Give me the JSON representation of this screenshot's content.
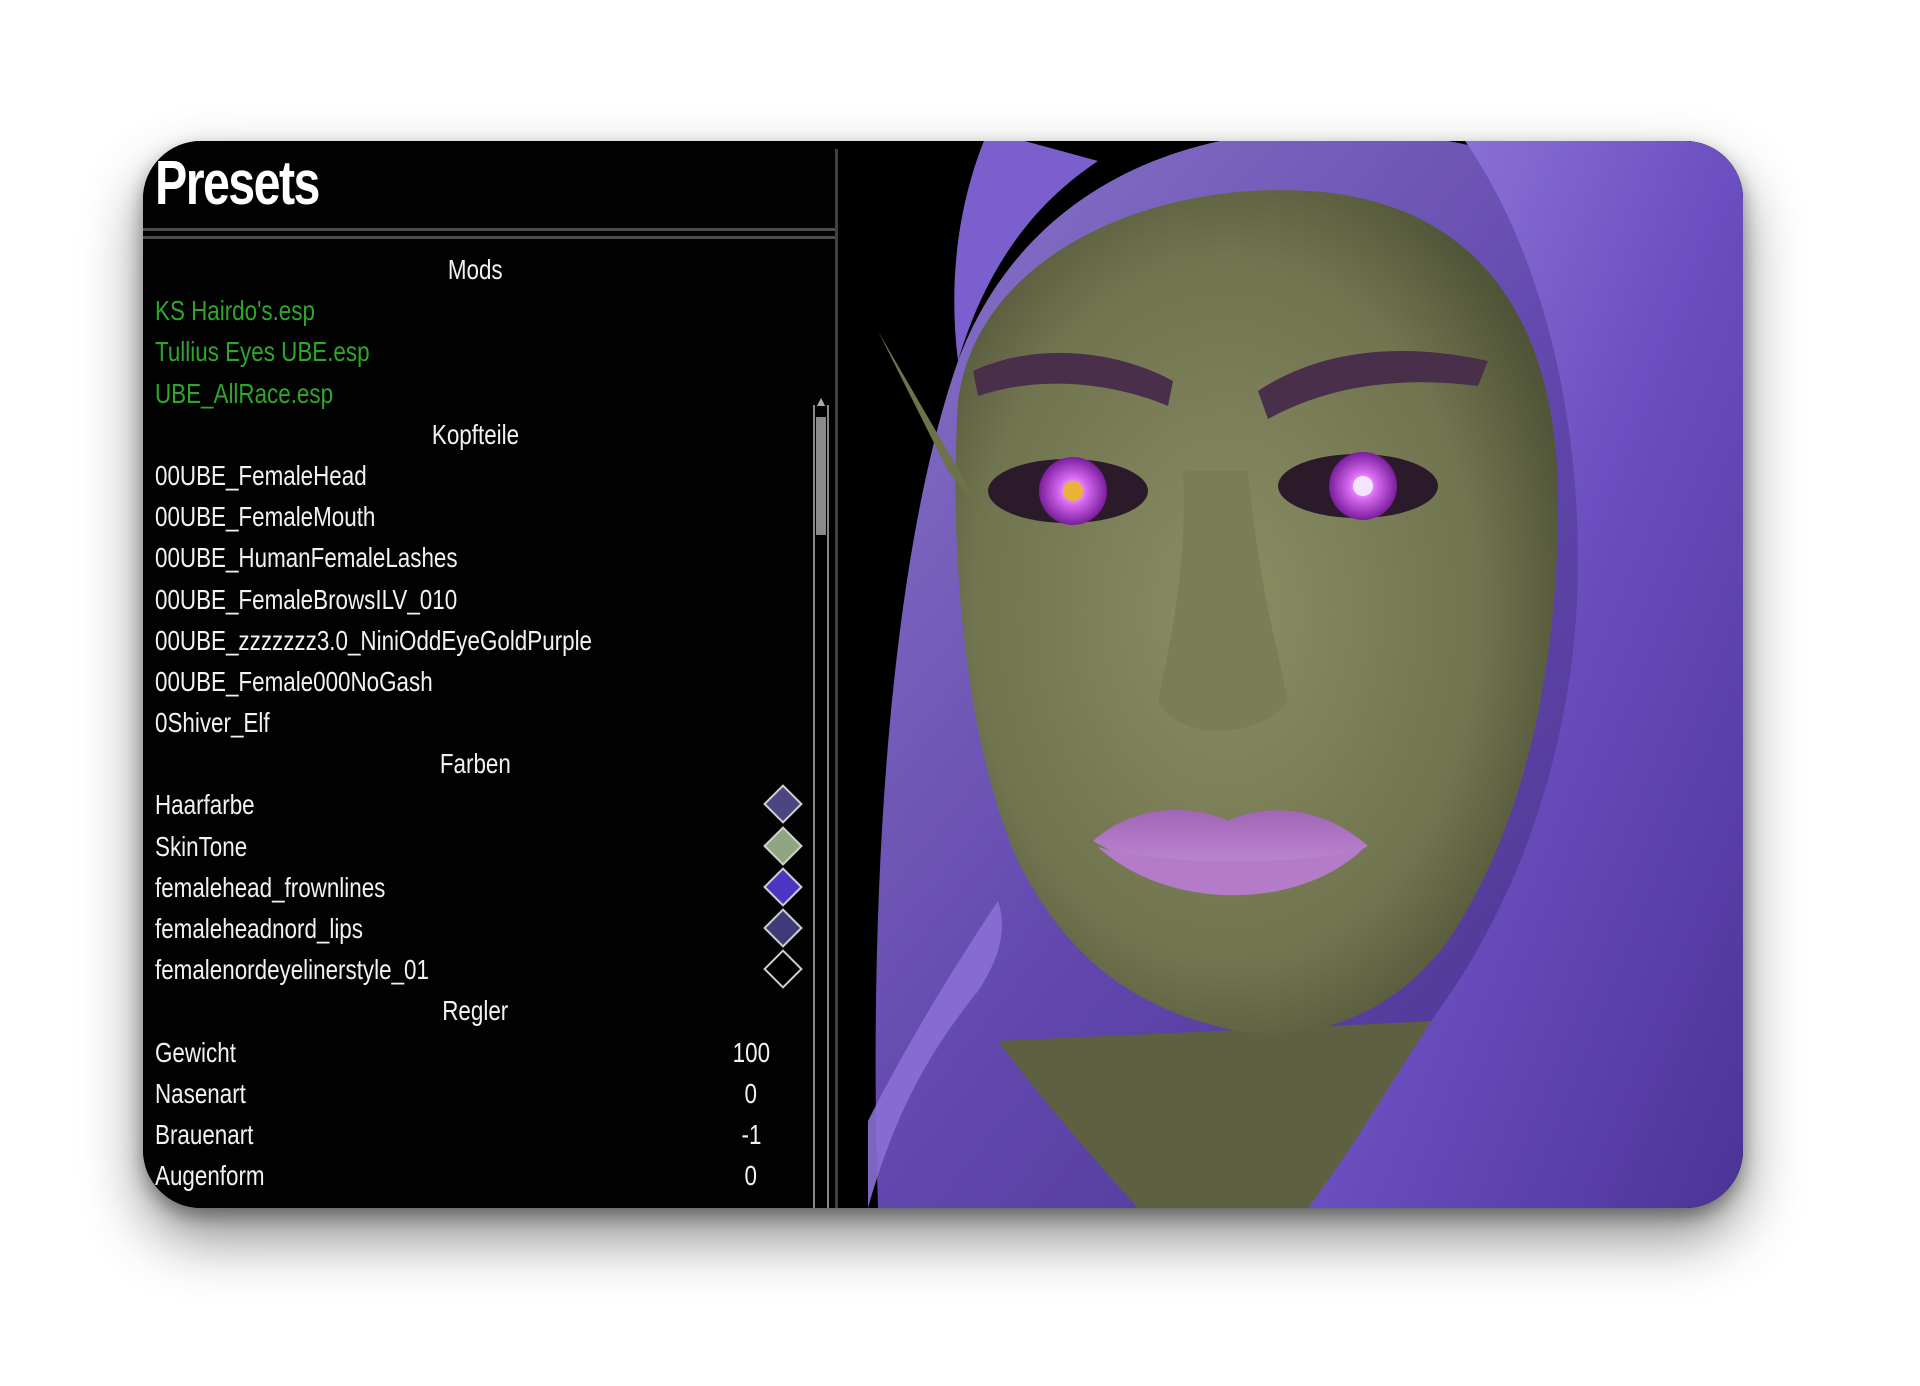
{
  "panel": {
    "title": "Presets",
    "sections": {
      "mods": "Mods",
      "headparts": "Kopfteile",
      "colors": "Farben",
      "sliders": "Regler"
    },
    "mods": [
      "KS Hairdo's.esp",
      "Tullius Eyes UBE.esp",
      "UBE_AllRace.esp"
    ],
    "headparts": [
      "00UBE_FemaleHead",
      "00UBE_FemaleMouth",
      "00UBE_HumanFemaleLashes",
      "00UBE_FemaleBrowsILV_010",
      "00UBE_zzzzzzz3.0_NiniOddEyeGoldPurple",
      "00UBE_Female000NoGash",
      "0Shiver_Elf"
    ],
    "colors": [
      {
        "label": "Haarfarbe",
        "color": "#4c4680"
      },
      {
        "label": "SkinTone",
        "color": "#8fa781"
      },
      {
        "label": "femalehead_frownlines",
        "color": "#4b36c4"
      },
      {
        "label": "femaleheadnord_lips",
        "color": "#3f3a78"
      },
      {
        "label": "femalenordeyelinerstyle_01",
        "color": "#000000"
      }
    ],
    "sliders": [
      {
        "label": "Gewicht",
        "value": "100"
      },
      {
        "label": "Nasenart",
        "value": "0"
      },
      {
        "label": "Brauenart",
        "value": "-1"
      },
      {
        "label": "Augenform",
        "value": "0"
      }
    ],
    "accent_mod_color": "#2fa62a"
  },
  "portrait": {
    "subject": "green-skinned elf with purple hair and violet eyes",
    "hair_color": "#7a5fc4",
    "skin_color": "#7d805a",
    "lip_color": "#9a62b0"
  }
}
